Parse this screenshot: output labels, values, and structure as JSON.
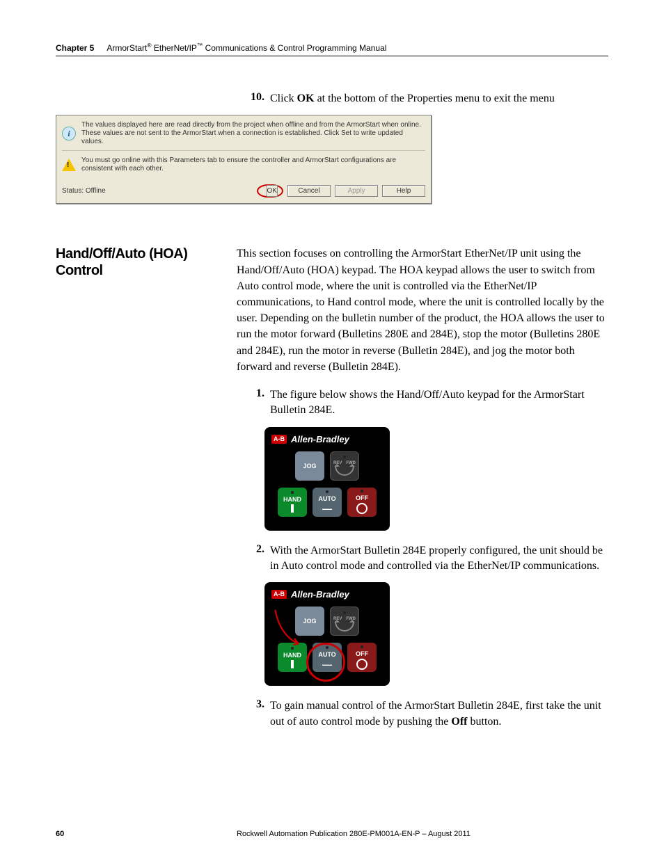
{
  "header": {
    "chapter_label": "Chapter 5",
    "title_prefix": "ArmorStart",
    "title_mid": " EtherNet/IP",
    "title_suffix": " Communications & Control Programming Manual",
    "reg": "®",
    "tm": "™"
  },
  "step10": {
    "num": "10.",
    "text_before": "Click ",
    "ok": "OK",
    "text_after": " at the bottom of the Properties menu to exit the menu"
  },
  "dialog": {
    "info_text": "The values displayed here are read directly from the project when offline and from the ArmorStart when online. These values are not sent to the ArmorStart when a connection is established. Click Set to write updated values.",
    "warn_text": "You must go online with this Parameters tab to ensure the controller and ArmorStart configurations are consistent with each other.",
    "status": "Status: Offline",
    "ok": "OK",
    "cancel": "Cancel",
    "apply": "Apply",
    "help": "Help"
  },
  "section": {
    "heading": "Hand/Off/Auto (HOA) Control",
    "intro": "This section focuses on controlling the ArmorStart EtherNet/IP unit using the Hand/Off/Auto (HOA) keypad. The HOA keypad allows the user to switch from Auto control mode, where the unit is controlled via the EtherNet/IP communications, to Hand control mode, where the unit is controlled locally by the user. Depending on the bulletin number of the product, the HOA allows the user to run the motor forward (Bulletins 280E and 284E), stop the motor (Bulletins 280E and 284E), run the motor in reverse (Bulletin 284E), and jog the motor both forward and reverse (Bulletin 284E)."
  },
  "steps": {
    "s1": {
      "num": "1.",
      "text": "The figure below shows the Hand/Off/Auto keypad for the ArmorStart Bulletin 284E."
    },
    "s2": {
      "num": "2.",
      "text": "With the ArmorStart Bulletin 284E properly configured, the unit should be in Auto control mode and controlled via the EtherNet/IP communications."
    },
    "s3": {
      "num": "3.",
      "text_before": "To gain manual control of the ArmorStart Bulletin 284E, first take the unit out of auto control mode by pushing the ",
      "off": "Off",
      "text_after": " button."
    }
  },
  "keypad": {
    "brand": "Allen-Bradley",
    "logo": "A-B",
    "jog": "JOG",
    "rev": "REV",
    "fwd": "FWD",
    "hand": "HAND",
    "auto": "AUTO",
    "off": "OFF"
  },
  "footer": {
    "page": "60",
    "pub": "Rockwell Automation Publication 280E-PM001A-EN-P – August 2011"
  }
}
